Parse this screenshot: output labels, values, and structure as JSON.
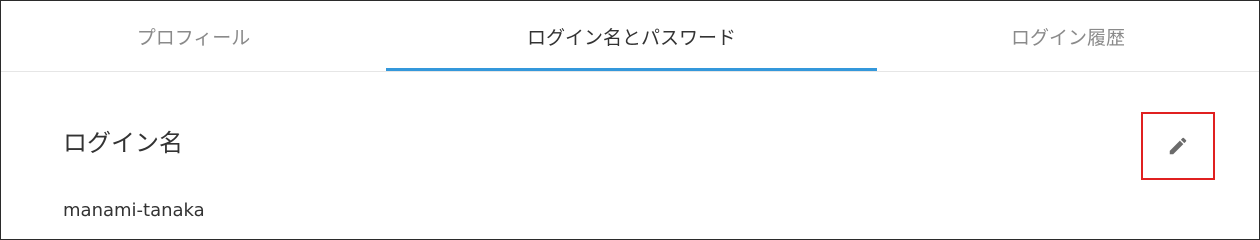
{
  "tabs": [
    {
      "label": "プロフィール"
    },
    {
      "label": "ログイン名とパスワード"
    },
    {
      "label": "ログイン履歴"
    }
  ],
  "active_tab": "ログイン名とパスワード",
  "section": {
    "title": "ログイン名",
    "value": "manami-tanaka"
  },
  "edit": {
    "icon": "pencil-icon"
  },
  "colors": {
    "accent": "#3498db",
    "highlight_border": "#e02020",
    "active_text": "#333333",
    "inactive_text": "#8a8a8a"
  }
}
